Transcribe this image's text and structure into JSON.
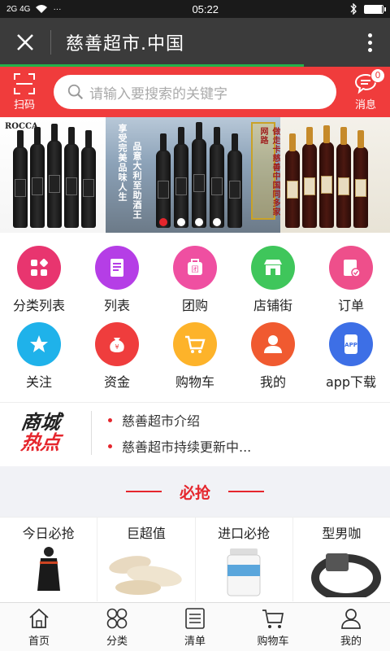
{
  "status_bar": {
    "left": "2G  4G",
    "time": "05:22"
  },
  "title_bar": {
    "title": "慈善超市.中国",
    "progress": 0.78
  },
  "search": {
    "scan_label": "扫码",
    "placeholder": "请输入要搜索的关键字",
    "message_label": "消息",
    "message_count": "0"
  },
  "banner": {
    "left_brand": "ROCCA",
    "mid_text_1": "享受完美品味人生",
    "mid_text_2": "品意大利至助酒王",
    "mid_slogan": "做走卡慈善中国同多家网路",
    "active_dot": 0,
    "dot_count": 4
  },
  "nav": [
    {
      "label": "分类列表",
      "icon": "category-icon",
      "color": "#e8356f"
    },
    {
      "label": "列表",
      "icon": "list-icon",
      "color": "#b53ee6"
    },
    {
      "label": "团购",
      "icon": "group-buy-icon",
      "color": "#ef4fa1"
    },
    {
      "label": "店铺街",
      "icon": "store-icon",
      "color": "#3fc65b"
    },
    {
      "label": "订单",
      "icon": "order-icon",
      "color": "#ee4f8b"
    },
    {
      "label": "关注",
      "icon": "star-icon",
      "color": "#1fb2ea"
    },
    {
      "label": "资金",
      "icon": "money-bag-icon",
      "color": "#ef3d3d"
    },
    {
      "label": "购物车",
      "icon": "cart-icon",
      "color": "#fdb32a"
    },
    {
      "label": "我的",
      "icon": "user-icon",
      "color": "#f05a30"
    },
    {
      "label": "app下载",
      "icon": "app-icon",
      "color": "#3d6fe6"
    }
  ],
  "news": {
    "logo_top": "商城",
    "logo_bottom": "热点",
    "items": [
      "慈善超市介绍",
      "慈善超市持续更新中..."
    ]
  },
  "flash_sale": {
    "title": "必抢",
    "cells": [
      "今日必抢",
      "巨超值",
      "进口必抢",
      "型男咖"
    ]
  },
  "tabs": [
    {
      "label": "首页",
      "icon": "home-icon"
    },
    {
      "label": "分类",
      "icon": "category-tab-icon"
    },
    {
      "label": "清单",
      "icon": "list-tab-icon"
    },
    {
      "label": "购物车",
      "icon": "cart-tab-icon"
    },
    {
      "label": "我的",
      "icon": "profile-tab-icon"
    }
  ]
}
